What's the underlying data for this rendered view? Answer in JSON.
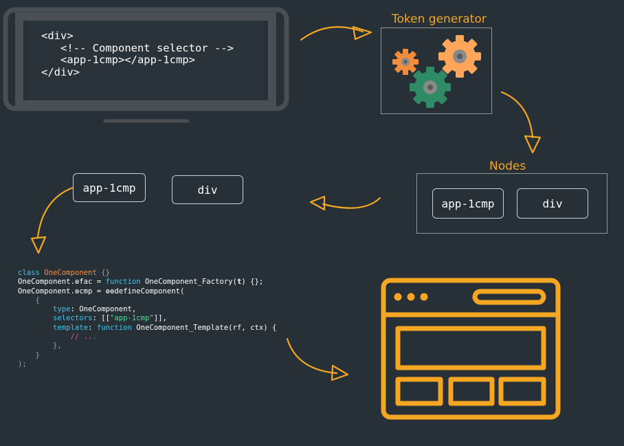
{
  "top_code": {
    "line1": "<div>",
    "line2": "   <!-- Component selector -->",
    "line3": "   <app-1cmp></app-1cmp>",
    "line4": "</div>"
  },
  "token_generator": {
    "label": "Token generator"
  },
  "nodes_panel": {
    "label": "Nodes",
    "items": [
      {
        "label": "app-1cmp"
      },
      {
        "label": "div"
      }
    ]
  },
  "tree_nodes": [
    {
      "label": "app-1cmp"
    },
    {
      "label": "div"
    }
  ],
  "bottom_code": {
    "l1_kw": "class",
    "l1_cls": "OneComponent",
    "l1_rest": " {}",
    "l2_a": "OneComponent.",
    "l2_b": "ɵfac",
    "l2_c": " = ",
    "l2_kw": "function",
    "l2_d": " OneComponent_Factory(",
    "l2_t": "t",
    "l2_e": ") {};",
    "l3_a": "OneComponent.",
    "l3_b": "ɵcmp",
    "l3_c": " = ɵɵdefineComponent(",
    "l4": "    {",
    "l5_key": "        type",
    "l5_val": ": OneComponent,",
    "l6_key": "        selectors",
    "l6_a": ": [[",
    "l6_str": "\"app-1cmp\"",
    "l6_b": "]],",
    "l7_key": "        template",
    "l7_a": ": ",
    "l7_kw": "function",
    "l7_b": " OneComponent_Template(rf, ctx) {",
    "l8_cm": "            // ...",
    "l9": "        },",
    "l10": "    }",
    "l11": ");"
  },
  "colors": {
    "background": "#263036",
    "accent_orange": "#f5a623",
    "monitor_frame": "#4a4f53",
    "gear_orange_small": "#f28c3c",
    "gear_orange_large": "#ffa65a",
    "gear_green": "#2f8a66"
  }
}
